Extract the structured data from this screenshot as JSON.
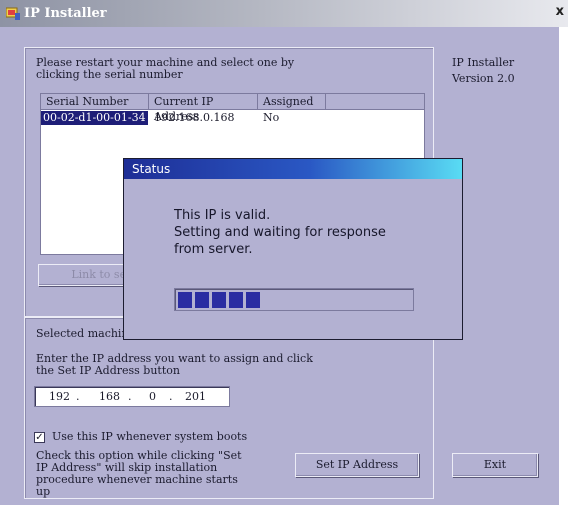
{
  "window": {
    "title": "IP Installer",
    "close_glyph": "x"
  },
  "about": {
    "name": "IP Installer",
    "version": "Version 2.0"
  },
  "instructions": "Please restart your machine and select one by clicking the serial number",
  "list": {
    "columns": [
      "Serial Number",
      "Current IP Address",
      "Assigned"
    ],
    "rows": [
      {
        "serial": "00-02-d1-00-01-34",
        "ip": "192.168.0.168",
        "assigned": "No"
      }
    ]
  },
  "link_button_label": "Link to selected device",
  "selected_machine_label": "Selected machine",
  "ip_instructions": "Enter the IP address you want to assign and click the Set IP Address button",
  "ip_address": {
    "octets": [
      "192",
      "168",
      "0",
      "201"
    ]
  },
  "use_ip_checkbox": {
    "label": "Use this IP whenever system boots",
    "checked": true,
    "glyph": "✓"
  },
  "check_note": "Check this option while clicking \"Set IP Address\" will skip installation procedure whenever machine starts up",
  "set_ip_button": "Set IP Address",
  "exit_button": "Exit",
  "status_dialog": {
    "title": "Status",
    "message_line1": "This IP is valid.",
    "message_line2": "Setting and waiting for response",
    "message_line3": "from server.",
    "progress_blocks_filled": 5,
    "progress_fraction": 0.36
  },
  "colors": {
    "dialog_face": "#b3b1d2",
    "progress_fill": "#2a2ca2",
    "selection": "#1e1e78"
  },
  "icons": [
    "app-icon",
    "close-icon",
    "checkmark-icon"
  ]
}
